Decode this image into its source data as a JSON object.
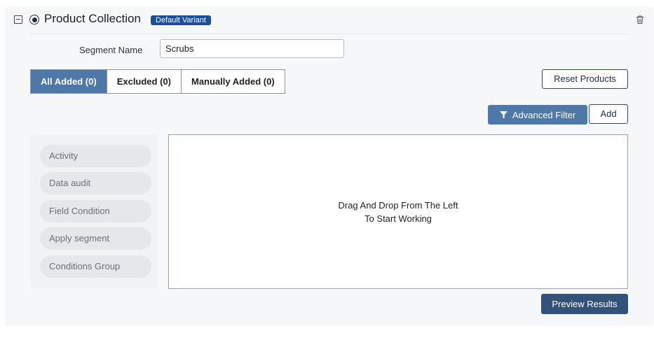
{
  "header": {
    "title": "Product Collection",
    "badge": "Default Variant",
    "icons": [
      "collapse-icon",
      "radio-icon",
      "trash-icon"
    ]
  },
  "segment": {
    "label": "Segment Name",
    "value": "Scrubs"
  },
  "tabs": [
    {
      "label": "All Added (0)",
      "active": true
    },
    {
      "label": "Excluded (0)",
      "active": false
    },
    {
      "label": "Manually Added (0)",
      "active": false
    }
  ],
  "toolbar": {
    "reset_label": "Reset Products",
    "advanced_filter_label": "Advanced Filter",
    "add_label": "Add"
  },
  "palette": {
    "items": [
      "Activity",
      "Data audit",
      "Field Condition",
      "Apply segment",
      "Conditions Group"
    ]
  },
  "canvas": {
    "hint_line1": "Drag And Drop From The Left",
    "hint_line2": "To Start Working"
  },
  "footer": {
    "preview_label": "Preview Results"
  },
  "colors": {
    "primary": "#4d78a8",
    "badge": "#1b4f9c",
    "preview": "#33527a"
  }
}
